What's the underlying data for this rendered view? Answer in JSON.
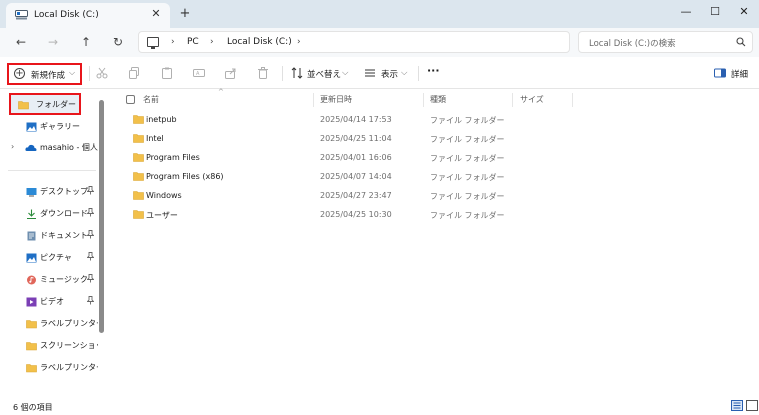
{
  "tab": {
    "title": "Local Disk (C:)",
    "close": "✕",
    "new_tab": "+"
  },
  "window": {
    "minimize": "—",
    "maximize": "☐",
    "close": "✕"
  },
  "nav": {
    "back": "←",
    "forward": "→",
    "up": "↑",
    "refresh": "↻"
  },
  "address": {
    "crumbs": [
      "PC",
      "Local Disk (C:)"
    ],
    "separator": "›"
  },
  "search": {
    "placeholder": "Local Disk (C:)の検索"
  },
  "toolbar": {
    "new_label": "新規作成",
    "sort_label": "並べ替え",
    "view_label": "表示",
    "more": "···",
    "details_label": "詳細",
    "caret": "⌵"
  },
  "sidebar": {
    "items": [
      {
        "label": "フォルダー",
        "icon": "folder-icon"
      },
      {
        "label": "ギャラリー",
        "icon": "gallery-icon"
      },
      {
        "label": "masahio - 個人用",
        "icon": "onedrive-icon"
      },
      {
        "label": "デスクトップ",
        "icon": "desktop-icon"
      },
      {
        "label": "ダウンロード",
        "icon": "download-icon"
      },
      {
        "label": "ドキュメント",
        "icon": "document-icon"
      },
      {
        "label": "ピクチャ",
        "icon": "pictures-icon"
      },
      {
        "label": "ミュージック",
        "icon": "music-icon"
      },
      {
        "label": "ビデオ",
        "icon": "video-icon"
      },
      {
        "label": "ラベルプリンタードライバー",
        "icon": "folder-icon"
      },
      {
        "label": "スクリーンショット",
        "icon": "folder-icon"
      },
      {
        "label": "ラベルプリンタードライバー",
        "icon": "folder-icon"
      }
    ],
    "pin": "📌",
    "expander": "›"
  },
  "columns": {
    "name": "名前",
    "date": "更新日時",
    "type": "種類",
    "size": "サイズ",
    "sort_indicator": "^"
  },
  "files": [
    {
      "name": "inetpub",
      "date": "2025/04/14 17:53",
      "type": "ファイル フォルダー"
    },
    {
      "name": "Intel",
      "date": "2025/04/25 11:04",
      "type": "ファイル フォルダー"
    },
    {
      "name": "Program Files",
      "date": "2025/04/01 16:06",
      "type": "ファイル フォルダー"
    },
    {
      "name": "Program Files (x86)",
      "date": "2025/04/07 14:04",
      "type": "ファイル フォルダー"
    },
    {
      "name": "Windows",
      "date": "2025/04/27 23:47",
      "type": "ファイル フォルダー"
    },
    {
      "name": "ユーザー",
      "date": "2025/04/25 10:30",
      "type": "ファイル フォルダー"
    }
  ],
  "status": {
    "item_count": "6 個の項目"
  },
  "colors": {
    "highlight_box": "#e8151b",
    "folder": "#f2c04a",
    "accent": "#2a5fb0",
    "titlebar": "#dce6ee"
  }
}
